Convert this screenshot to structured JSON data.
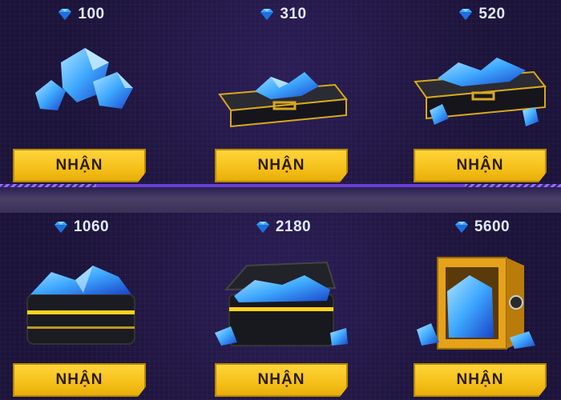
{
  "rewards": [
    {
      "amount": "100",
      "button_label": "NHẬN",
      "item": "diamond-pile"
    },
    {
      "amount": "310",
      "button_label": "NHẬN",
      "item": "briefcase-closed"
    },
    {
      "amount": "520",
      "button_label": "NHẬN",
      "item": "briefcase-open"
    },
    {
      "amount": "1060",
      "button_label": "NHẬN",
      "item": "crate"
    },
    {
      "amount": "2180",
      "button_label": "NHẬN",
      "item": "chest"
    },
    {
      "amount": "5600",
      "button_label": "NHẬN",
      "item": "safe"
    }
  ],
  "currency_icon": "diamond-icon",
  "colors": {
    "background": "#1f1640",
    "button": "#f5c01a",
    "divider_accent": "#6a3fd6",
    "diamond": "#3ea8ff"
  }
}
